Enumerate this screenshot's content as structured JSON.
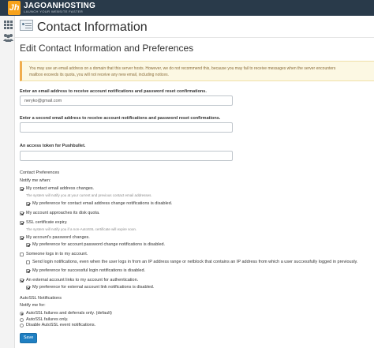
{
  "brand": {
    "logo_letters": "Jh",
    "name": "JAGOANHOSTING",
    "tagline": "LAUNCH YOUR WEBSITE FASTER",
    "topbar_color": "#293a4a",
    "logo_color": "#f7a21b"
  },
  "sidebar": {
    "icons": [
      "grid-icon",
      "users-icon"
    ]
  },
  "header": {
    "title": "Contact Information"
  },
  "main": {
    "section_title": "Edit Contact Information and Preferences",
    "warning_lines": [
      "You may use an email address on a domain that this server hosts. However, we do not recommend this, because you may fail to receive messages when the server encounters",
      "mailbox exceeds its quota, you will not receive any new email, including notices."
    ],
    "email1": {
      "label": "Enter an email address to receive account notifications and password reset confirmations.",
      "value": "neryko@gmail.com"
    },
    "email2": {
      "label": "Enter a second email address to receive account notifications and password reset confirmations.",
      "value": ""
    },
    "pushbullet": {
      "label": "An access token for Pushbullet.",
      "value": ""
    },
    "contact_prefs": {
      "title": "Contact Preferences",
      "notify_label": "Notify me when:",
      "items": [
        {
          "label": "My contact email address changes.",
          "checked": true
        },
        {
          "note": "The system will notify you at your current and previous contact email addresses."
        },
        {
          "label": "My preference for contact email address change notifications is disabled.",
          "checked": true
        },
        {
          "label": "My account approaches its disk quota.",
          "checked": true
        },
        {
          "label": "SSL certificate expiry.",
          "checked": true
        },
        {
          "note": "The system will notify you if a non-AutoSSL certificate will expire soon."
        },
        {
          "label": "My account's password changes.",
          "checked": true
        },
        {
          "label": "My preference for account password change notifications is disabled.",
          "checked": true
        },
        {
          "label": "Someone logs in to my account.",
          "checked": false
        },
        {
          "label": "Send login notifications, even when the user logs in from an IP address range or netblock that contains an IP address from which a user successfully logged in previously.",
          "checked": false
        },
        {
          "label": "My preference for successful login notifications is disabled.",
          "checked": true
        },
        {
          "label": "An external account links to my account for authentication.",
          "checked": true
        },
        {
          "label": "My preference for external account link notifications is disabled.",
          "checked": true
        }
      ]
    },
    "autossl": {
      "title": "AutoSSL Notifications",
      "notify_label": "Notify me for:",
      "options": [
        {
          "label": "AutoSSL failures and deferrals only. (default)",
          "selected": true
        },
        {
          "label": "AutoSSL failures only.",
          "selected": false
        },
        {
          "label": "Disable AutoSSL event notifications.",
          "selected": false
        }
      ]
    },
    "save_label": "Save",
    "accent_color": "#1f7fc2"
  }
}
